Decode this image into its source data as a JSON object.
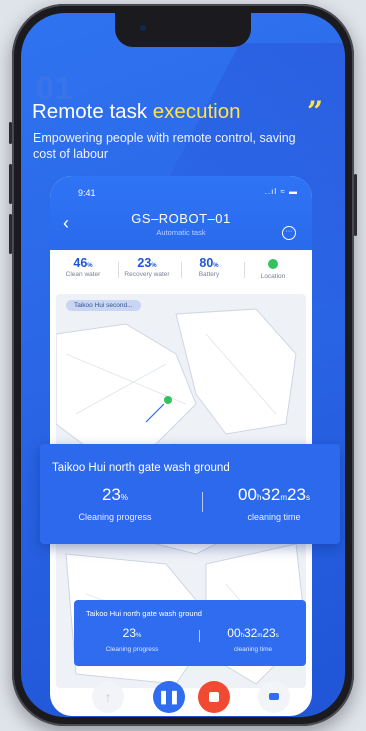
{
  "hero": {
    "number": "01",
    "title_main": "Remote task",
    "title_highlight": "execution",
    "quote_mark": "”",
    "subtitle": "Empowering people with remote  control, saving cost of labour"
  },
  "app": {
    "status_time": "9:41",
    "status_icons": "..ıl ≈ ▬",
    "robot_name": "GS–ROBOT–01",
    "mode": "Automatic task",
    "back_icon": "chevron-left-icon",
    "more_icon": "more-icon"
  },
  "stats": [
    {
      "value": "46",
      "unit": "%",
      "label": "Clean water"
    },
    {
      "value": "23",
      "unit": "%",
      "label": "Recovery water"
    },
    {
      "value": "80",
      "unit": "%",
      "label": "Battery"
    },
    {
      "label": "Location"
    }
  ],
  "map": {
    "location_chip": "Taikoo Hui second..."
  },
  "task_card_large": {
    "title": "Taikoo Hui north gate wash ground",
    "progress_value": "23",
    "progress_unit": "%",
    "progress_label": "Cleaning progress",
    "time_h": "00",
    "time_h_unit": "h",
    "time_m": "32",
    "time_m_unit": "m",
    "time_s": "23",
    "time_s_unit": "s",
    "time_label": "cleaning time"
  },
  "task_card_small": {
    "title": "Taikoo Hui north gate wash ground",
    "progress_value": "23",
    "progress_unit": "%",
    "progress_label": "Cleaning progress",
    "time_h": "00",
    "time_h_unit": "h",
    "time_m": "32",
    "time_m_unit": "m",
    "time_s": "23",
    "time_s_unit": "s",
    "time_label": "cleaning time"
  },
  "controls": {
    "up_icon": "arrow-up-icon",
    "pause_icon": "pause-icon",
    "stop_icon": "stop-icon",
    "camera_icon": "camera-icon"
  },
  "colors": {
    "primary": "#2f6cf0",
    "highlight": "#ffe24a",
    "stop": "#f04a32",
    "location_ok": "#33c25b"
  }
}
